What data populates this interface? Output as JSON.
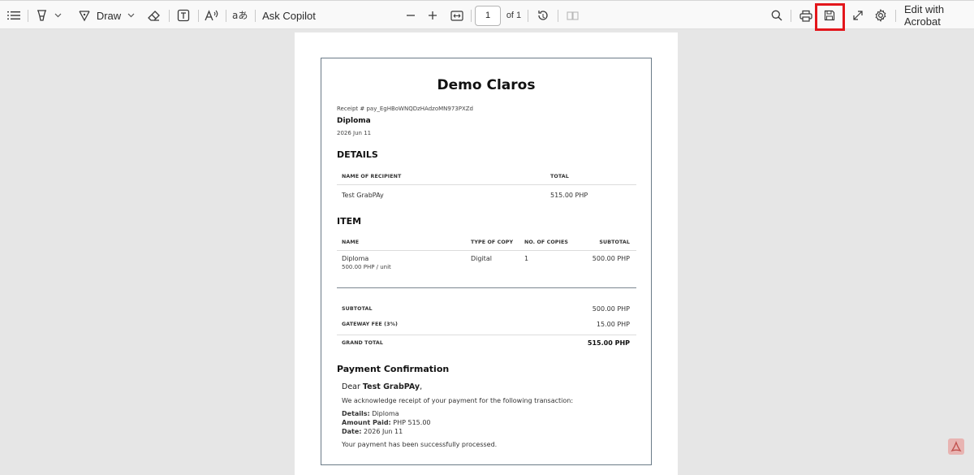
{
  "toolbar": {
    "draw_label": "Draw",
    "ask_copilot_label": "Ask Copilot",
    "page_current": "1",
    "page_total": "of 1",
    "edit_with_acrobat_label": "Edit with Acrobat",
    "icons": {
      "contents": "list-icon",
      "highlight": "highlighter-icon",
      "draw": "pen-icon",
      "erase": "eraser-icon",
      "text": "text-box-icon",
      "read_aloud": "read-aloud-icon",
      "translate": "translate-icon",
      "zoom_out": "minus-icon",
      "zoom_in": "plus-icon",
      "fit": "fit-width-icon",
      "rotate": "rotate-icon",
      "page_view": "page-view-icon",
      "search": "search-icon",
      "print": "print-icon",
      "save": "save-icon",
      "fullscreen": "expand-icon",
      "settings": "gear-icon"
    },
    "highlight_color": "#e3161b"
  },
  "receipt": {
    "title": "Demo Claros",
    "receipt_number": "Receipt # pay_EgHBoWNQDzHAdzoMN973PXZd",
    "product": "Diploma",
    "date": "2026 Jun 11",
    "details_heading": "DETAILS",
    "details_headers": {
      "recipient": "NAME OF RECIPIENT",
      "total": "TOTAL"
    },
    "details_row": {
      "recipient": "Test GrabPAy",
      "total": "515.00 PHP"
    },
    "item_heading": "ITEM",
    "item_headers": {
      "name": "NAME",
      "type": "TYPE OF COPY",
      "copies": "NO. OF COPIES",
      "subtotal": "SUBTOTAL"
    },
    "item_row": {
      "name": "Diploma",
      "unit_price": "500.00 PHP / unit",
      "type": "Digital",
      "copies": "1",
      "subtotal": "500.00 PHP"
    },
    "totals": {
      "subtotal_label": "SUBTOTAL",
      "subtotal_value": "500.00 PHP",
      "fee_label": "GATEWAY FEE (3%)",
      "fee_value": "15.00 PHP",
      "grand_label": "GRAND TOTAL",
      "grand_value": "515.00 PHP"
    },
    "confirmation": {
      "heading": "Payment Confirmation",
      "dear": "Dear",
      "dear_name": "Test GrabPAy",
      "dear_suffix": ",",
      "ack": "We acknowledge receipt of your payment for the following transaction:",
      "details_label": "Details:",
      "details_value": "Diploma",
      "amount_label": "Amount Paid:",
      "amount_value": "PHP 515.00",
      "date_label": "Date:",
      "date_value": "2026 Jun 11",
      "processed": "Your payment has been successfully processed."
    }
  }
}
